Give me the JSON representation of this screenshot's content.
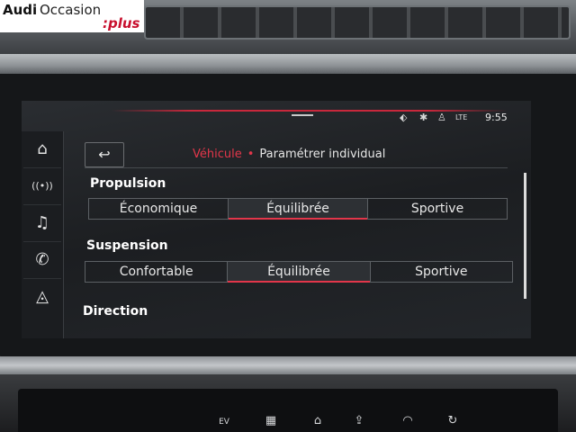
{
  "logo": {
    "brand": "Audi",
    "name": "Occasion",
    "suffix": ":plus"
  },
  "status": {
    "time": "9:55",
    "icons": [
      "navigation-status-icon",
      "bluetooth-icon",
      "user-profile-icon",
      "lte-signal-icon"
    ],
    "lte_label": "LTE"
  },
  "sidebar": {
    "items": [
      {
        "icon": "home-icon",
        "glyph": "⌂"
      },
      {
        "icon": "radio-icon",
        "glyph": "((•))"
      },
      {
        "icon": "music-icon",
        "glyph": "♫"
      },
      {
        "icon": "phone-icon",
        "glyph": "✆"
      },
      {
        "icon": "navigation-icon",
        "glyph": "◬"
      }
    ]
  },
  "header": {
    "back_glyph": "↩",
    "section": "Véhicule",
    "separator": "•",
    "page": "Paramétrer individual"
  },
  "propulsion": {
    "label": "Propulsion",
    "options": [
      "Économique",
      "Équilibrée",
      "Sportive"
    ],
    "selected": 1
  },
  "suspension": {
    "label": "Suspension",
    "options": [
      "Confortable",
      "Équilibrée",
      "Sportive"
    ],
    "selected": 1
  },
  "direction": {
    "label": "Direction"
  },
  "lower_controls": {
    "ev_label": "EV"
  },
  "colors": {
    "accent": "#e2364a",
    "background": "#1c1e21",
    "text": "#e8e8e8"
  }
}
